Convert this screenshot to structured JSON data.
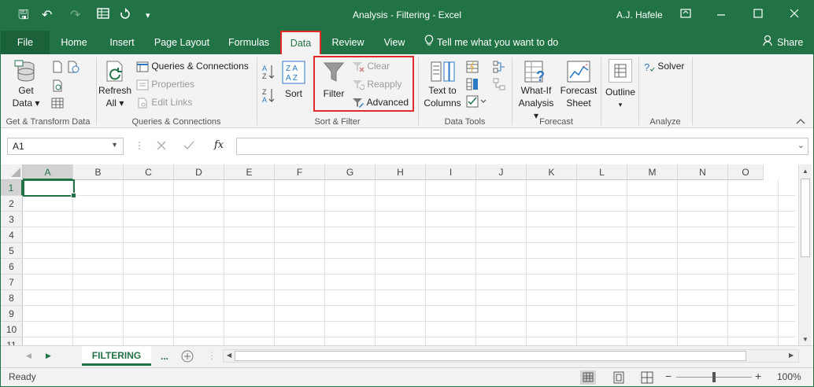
{
  "titlebar": {
    "title": "Analysis - Filtering - Excel",
    "user": "A.J. Hafele",
    "save_glyph": "🖫",
    "undo_glyph": "↶",
    "redo_glyph": "↷",
    "customize_glyph": "▾"
  },
  "tabs": [
    {
      "label": "File"
    },
    {
      "label": "Home"
    },
    {
      "label": "Insert"
    },
    {
      "label": "Page Layout"
    },
    {
      "label": "Formulas"
    },
    {
      "label": "Data"
    },
    {
      "label": "Review"
    },
    {
      "label": "View"
    }
  ],
  "tell_me": "Tell me what you want to do",
  "share": "Share",
  "ribbon": {
    "get_transform": {
      "get_data_line1": "Get",
      "get_data_line2": "Data",
      "label": "Get & Transform Data"
    },
    "queries": {
      "refresh_line1": "Refresh",
      "refresh_line2": "All",
      "queries_connections": "Queries & Connections",
      "properties": "Properties",
      "edit_links": "Edit Links",
      "label": "Queries & Connections"
    },
    "sort_filter": {
      "sort": "Sort",
      "filter": "Filter",
      "clear": "Clear",
      "reapply": "Reapply",
      "advanced": "Advanced",
      "label": "Sort & Filter"
    },
    "data_tools": {
      "ttc_line1": "Text to",
      "ttc_line2": "Columns",
      "label": "Data Tools"
    },
    "forecast": {
      "whatif_line1": "What-If",
      "whatif_line2": "Analysis",
      "fs_line1": "Forecast",
      "fs_line2": "Sheet",
      "label": "Forecast"
    },
    "outline": {
      "outline": "Outline"
    },
    "analyze": {
      "solver": "Solver",
      "label": "Analyze"
    }
  },
  "formula_bar": {
    "name_box": "A1",
    "fx": "fx",
    "formula_value": ""
  },
  "grid": {
    "columns": [
      "A",
      "B",
      "C",
      "D",
      "E",
      "F",
      "G",
      "H",
      "I",
      "J",
      "K",
      "L",
      "M",
      "N",
      "O"
    ],
    "rows": [
      "1",
      "2",
      "3",
      "4",
      "5",
      "6",
      "7",
      "8",
      "9",
      "10",
      "11"
    ],
    "selected_cell": "A1"
  },
  "sheets": {
    "active": "FILTERING",
    "more": "..."
  },
  "status": {
    "ready": "Ready",
    "zoom": "100%"
  },
  "colors": {
    "brand": "#217346",
    "highlight": "#e02b2b"
  }
}
